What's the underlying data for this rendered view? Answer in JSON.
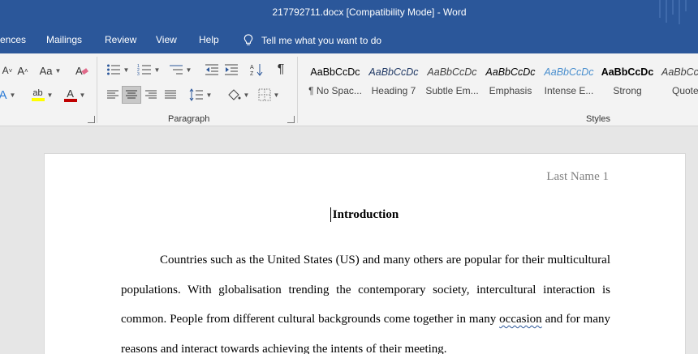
{
  "window": {
    "title": "217792711.docx [Compatibility Mode]  -  Word"
  },
  "menu": {
    "tabs": [
      "ences",
      "Mailings",
      "Review",
      "View",
      "Help"
    ],
    "tell_me": "Tell me what you want to do"
  },
  "ribbon": {
    "font": {
      "change_case": "Aa",
      "shrink_font": "A"
    },
    "groups": {
      "paragraph": "Paragraph",
      "styles": "Styles"
    },
    "paragraph_mark": "¶",
    "styles": [
      {
        "sample": "AaBbCcDc",
        "name": "¶ No Spac..."
      },
      {
        "sample": "AaBbCcDc",
        "name": "Heading 7"
      },
      {
        "sample": "AaBbCcDc",
        "name": "Subtle Em..."
      },
      {
        "sample": "AaBbCcDc",
        "name": "Emphasis"
      },
      {
        "sample": "AaBbCcDc",
        "name": "Intense E..."
      },
      {
        "sample": "AaBbCcDc",
        "name": "Strong"
      },
      {
        "sample": "AaBbCcDc",
        "name": "Quote"
      }
    ]
  },
  "document": {
    "header": "Last Name 1",
    "heading": "Introduction",
    "paragraph_start": "Countries such as the United States (US) and many others are popular for their multicultural populations. With globalisation trending the contemporary society, intercultural interaction is common. People from different cultural backgrounds come together in many ",
    "misspelled_word": "occasion",
    "paragraph_end": " and for many reasons and interact towards achieving the intents of their meeting."
  },
  "colors": {
    "titlebar": "#2b579a",
    "ribbon": "#f3f3f3",
    "canvas": "#e6e6e6",
    "font_color_bar": "#c00000",
    "highlight_bar": "#ffff00"
  }
}
